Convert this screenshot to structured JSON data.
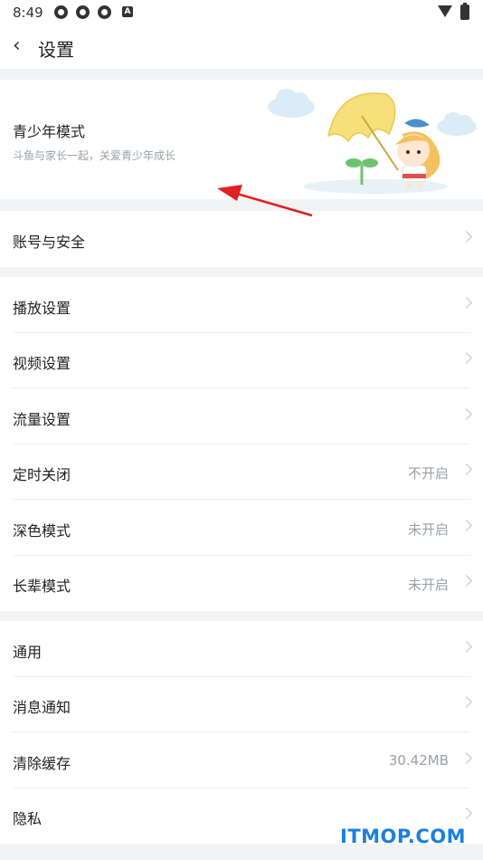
{
  "status_bar": {
    "time": "8:49",
    "a_badge": "A"
  },
  "header": {
    "title": "设置"
  },
  "teen_mode": {
    "title": "青少年模式",
    "subtitle": "斗鱼与家长一起，关爱青少年成长"
  },
  "account": {
    "label": "账号与安全"
  },
  "playback_group": [
    {
      "label": "播放设置",
      "value": ""
    },
    {
      "label": "视频设置",
      "value": ""
    },
    {
      "label": "流量设置",
      "value": ""
    },
    {
      "label": "定时关闭",
      "value": "不开启"
    },
    {
      "label": "深色模式",
      "value": "未开启"
    },
    {
      "label": "长辈模式",
      "value": "未开启"
    }
  ],
  "general_group": [
    {
      "label": "通用",
      "value": ""
    },
    {
      "label": "消息通知",
      "value": ""
    },
    {
      "label": "清除缓存",
      "value": "30.42MB"
    },
    {
      "label": "隐私",
      "value": ""
    }
  ],
  "watermark": "ITMOP.COM",
  "colors": {
    "annotation_arrow": "#e02020",
    "watermark": "#1a80e0",
    "umbrella": "#f7e07a"
  }
}
